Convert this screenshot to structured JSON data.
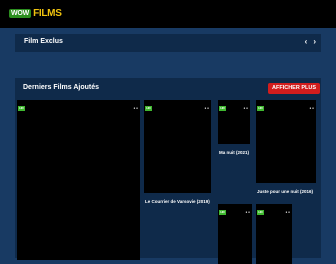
{
  "header": {
    "logo_badge": "WOW",
    "logo_text": "FILMS"
  },
  "film_exclus": {
    "title": "Film Exclus",
    "prev": "‹",
    "next": "›"
  },
  "latest": {
    "title": "Derniers Films Ajoutés",
    "more_label": "AFFICHER PLUS",
    "card_badge": "HD",
    "card_dots": "● ●",
    "films": [
      {
        "title": ""
      },
      {
        "title": "Le Courrier de Varsovie (2019)"
      },
      {
        "title": "Ma nuit (2021)"
      },
      {
        "title": "Juste pour une nuit (2016)"
      },
      {
        "title": ""
      },
      {
        "title": ""
      }
    ]
  },
  "colors": {
    "background": "#183a63",
    "panel": "#0f2a4a",
    "accent_button": "#d21d1d",
    "badge": "#3fb82f",
    "logo_yellow": "#f1c40f"
  }
}
